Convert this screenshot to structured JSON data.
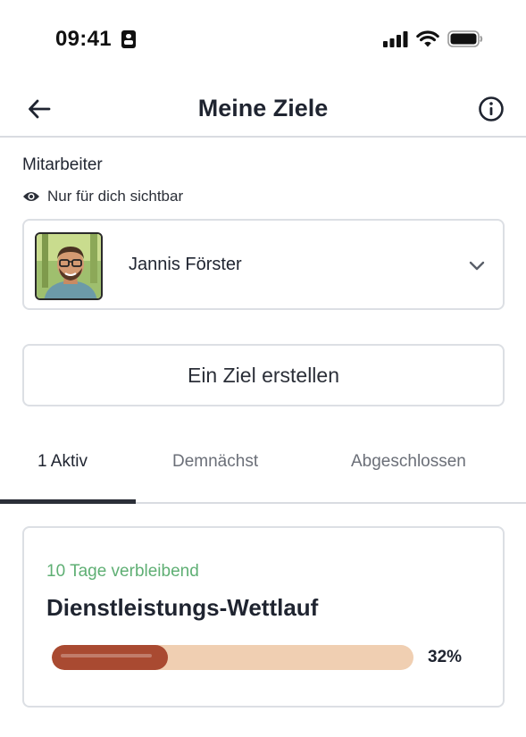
{
  "status_bar": {
    "time": "09:41",
    "icons": [
      "cellular-signal-icon",
      "wifi-icon",
      "battery-icon"
    ]
  },
  "header": {
    "title": "Meine Ziele",
    "back_icon": "arrow-left-icon",
    "info_icon": "info-icon"
  },
  "employee": {
    "label": "Mitarbeiter",
    "visibility_text": "Nur für dich sichtbar",
    "visibility_icon": "eye-icon",
    "selected_name": "Jannis Förster",
    "dropdown_icon": "chevron-down-icon"
  },
  "create_button": {
    "label": "Ein Ziel erstellen"
  },
  "tabs": [
    {
      "label": "1 Aktiv",
      "active": true
    },
    {
      "label": "Demnächst",
      "active": false
    },
    {
      "label": "Abgeschlossen",
      "active": false
    }
  ],
  "goal": {
    "remaining": "10 Tage verbleibend",
    "title": "Dienstleistungs-Wettlauf",
    "progress": 0.32,
    "progress_label": "32%"
  },
  "colors": {
    "remaining_green": "#5faf74",
    "progress_fill": "#a94a31",
    "progress_track": "#f0cfb2",
    "active_tab": "#2b2f38"
  }
}
